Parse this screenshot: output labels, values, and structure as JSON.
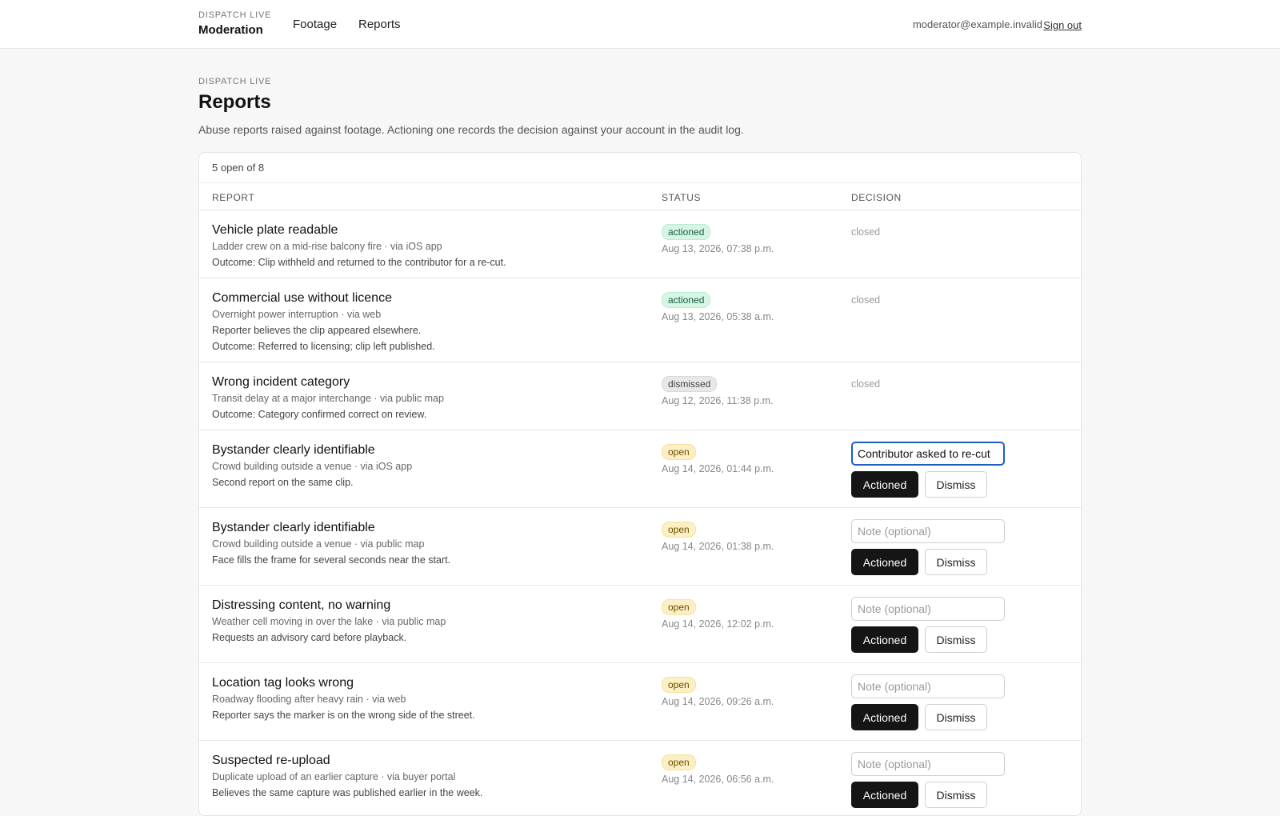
{
  "header": {
    "brand_kicker": "DISPATCH LIVE",
    "brand_title": "Moderation",
    "nav": [
      "Footage",
      "Reports"
    ],
    "user_email": "moderator@example.invalid",
    "sign_out": "Sign out"
  },
  "page": {
    "kicker": "DISPATCH LIVE",
    "title": "Reports",
    "description": "Abuse reports raised against footage. Actioning one records the decision against your account in the audit log."
  },
  "table": {
    "count_label": "5 open of 8",
    "columns": [
      "REPORT",
      "STATUS",
      "DECISION"
    ],
    "closed_label": "closed",
    "note_placeholder": "Note (optional)",
    "actioned_label": "Actioned",
    "dismiss_label": "Dismiss",
    "rows": [
      {
        "title": "Vehicle plate readable",
        "meta": "Ladder crew on a mid-rise balcony fire · via iOS app",
        "line1": "Outcome: Clip withheld and returned to the contributor for a re-cut.",
        "line2": "",
        "status": "actioned",
        "time": "Aug 13, 2026, 07:38 p.m."
      },
      {
        "title": "Commercial use without licence",
        "meta": "Overnight power interruption · via web",
        "line1": "Reporter believes the clip appeared elsewhere.",
        "line2": "Outcome: Referred to licensing; clip left published.",
        "status": "actioned",
        "time": "Aug 13, 2026, 05:38 a.m."
      },
      {
        "title": "Wrong incident category",
        "meta": "Transit delay at a major interchange · via public map",
        "line1": "Outcome: Category confirmed correct on review.",
        "line2": "",
        "status": "dismissed",
        "time": "Aug 12, 2026, 11:38 p.m."
      },
      {
        "title": "Bystander clearly identifiable",
        "meta": "Crowd building outside a venue · via iOS app",
        "line1": "Second report on the same clip.",
        "line2": "",
        "status": "open",
        "time": "Aug 14, 2026, 01:44 p.m.",
        "note": "Contributor asked to re-cut"
      },
      {
        "title": "Bystander clearly identifiable",
        "meta": "Crowd building outside a venue · via public map",
        "line1": "Face fills the frame for several seconds near the start.",
        "line2": "",
        "status": "open",
        "time": "Aug 14, 2026, 01:38 p.m.",
        "note": ""
      },
      {
        "title": "Distressing content, no warning",
        "meta": "Weather cell moving in over the lake · via public map",
        "line1": "Requests an advisory card before playback.",
        "line2": "",
        "status": "open",
        "time": "Aug 14, 2026, 12:02 p.m.",
        "note": ""
      },
      {
        "title": "Location tag looks wrong",
        "meta": "Roadway flooding after heavy rain · via web",
        "line1": "Reporter says the marker is on the wrong side of the street.",
        "line2": "",
        "status": "open",
        "time": "Aug 14, 2026, 09:26 a.m.",
        "note": ""
      },
      {
        "title": "Suspected re-upload",
        "meta": "Duplicate upload of an earlier capture · via buyer portal",
        "line1": "Believes the same capture was published earlier in the week.",
        "line2": "",
        "status": "open",
        "time": "Aug 14, 2026, 06:56 a.m.",
        "note": ""
      }
    ]
  }
}
